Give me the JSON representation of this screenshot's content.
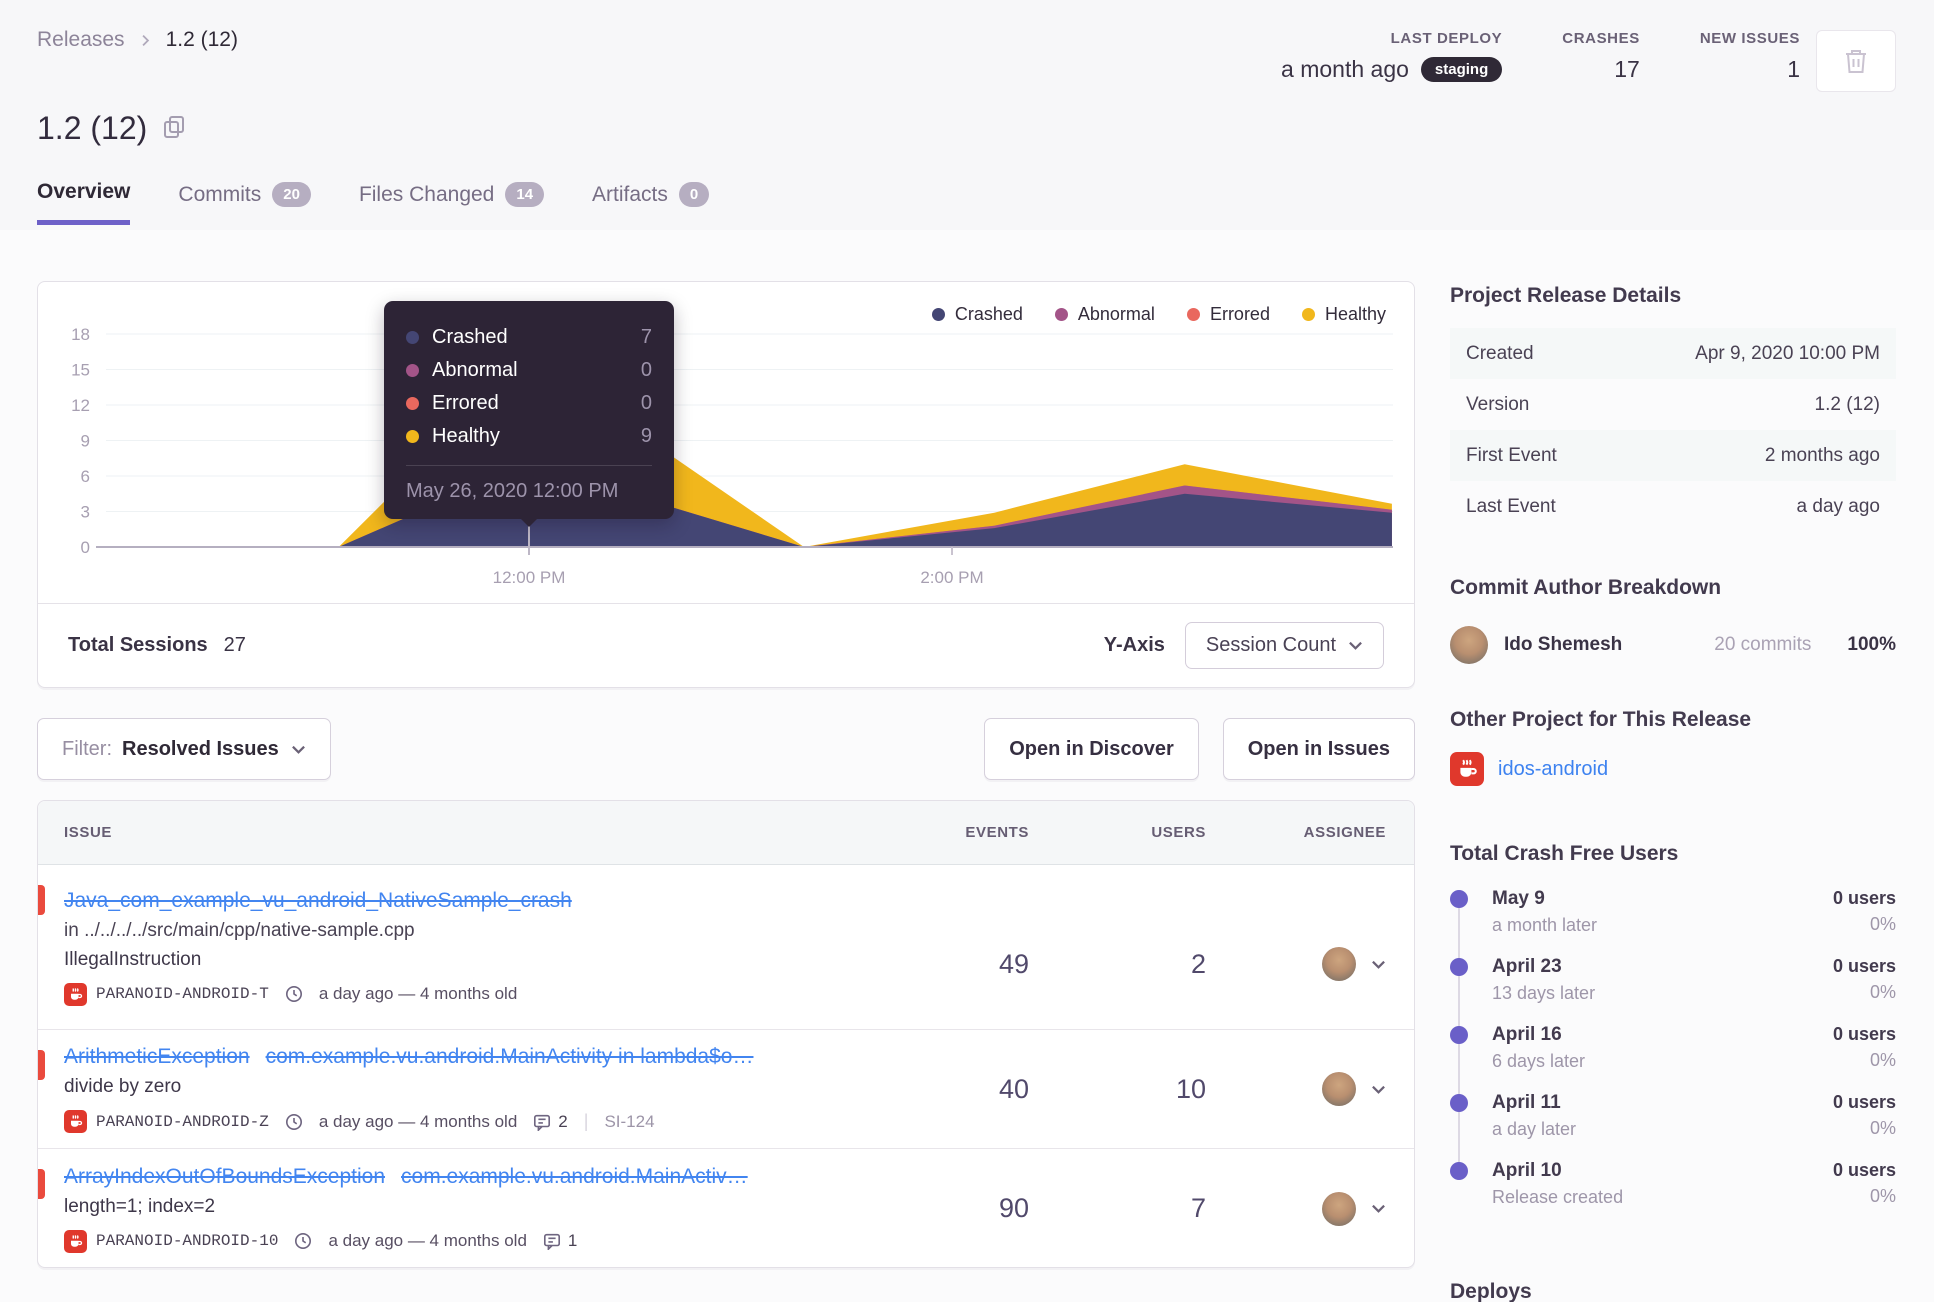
{
  "breadcrumb": {
    "section": "Releases",
    "current": "1.2 (12)"
  },
  "header_stats": {
    "last_deploy": {
      "label": "LAST DEPLOY",
      "value": "a month ago",
      "env_badge": "staging"
    },
    "crashes": {
      "label": "CRASHES",
      "value": "17"
    },
    "new_issues": {
      "label": "NEW ISSUES",
      "value": "1"
    }
  },
  "page_title": "1.2 (12)",
  "tabs": [
    {
      "label": "Overview"
    },
    {
      "label": "Commits",
      "badge": "20"
    },
    {
      "label": "Files Changed",
      "badge": "14"
    },
    {
      "label": "Artifacts",
      "badge": "0"
    }
  ],
  "colors": {
    "accent": "#6c5fc7",
    "link_blue": "#4285f0",
    "unhandled_red": "#ea4a3d",
    "crashed": "#444674",
    "abnormal": "#a35488",
    "errored": "#e9685e",
    "healthy": "#f1b71c"
  },
  "chart_card": {
    "total_sessions_label": "Total Sessions",
    "total_sessions_value": "27",
    "y_axis_label": "Y-Axis",
    "y_axis_selected": "Session Count"
  },
  "chart_data": {
    "type": "area",
    "stacked": true,
    "legend": [
      "Crashed",
      "Abnormal",
      "Errored",
      "Healthy"
    ],
    "legend_position": "top-right",
    "grid": true,
    "ylim": [
      0,
      18
    ],
    "y_ticks": [
      0,
      3,
      6,
      9,
      12,
      15,
      18
    ],
    "x_range": [
      10.0,
      16.085
    ],
    "x_ticks": [
      {
        "t": 12,
        "label": "12:00 PM"
      },
      {
        "t": 14,
        "label": "2:00 PM"
      }
    ],
    "colors": {
      "crashed": "#444674",
      "abnormal": "#a35488",
      "errored": "#e9685e",
      "healthy": "#f1b71c"
    },
    "series": [
      {
        "name": "Crashed",
        "points": [
          [
            10.0,
            0
          ],
          [
            11.1,
            0
          ],
          [
            12,
            7
          ],
          [
            13.3,
            0
          ],
          [
            14.2,
            1.6
          ],
          [
            15.1,
            4.5
          ],
          [
            16.08,
            2.9
          ]
        ]
      },
      {
        "name": "Abnormal",
        "points": [
          [
            10.0,
            0
          ],
          [
            11.1,
            0
          ],
          [
            12,
            0
          ],
          [
            13.3,
            0
          ],
          [
            14.2,
            0.2
          ],
          [
            15.1,
            0.7
          ],
          [
            16.08,
            0.25
          ]
        ]
      },
      {
        "name": "Errored",
        "points": [
          [
            10.0,
            0
          ],
          [
            11.1,
            0
          ],
          [
            12,
            0
          ],
          [
            13.3,
            0
          ],
          [
            14.2,
            0
          ],
          [
            15.1,
            0
          ],
          [
            16.08,
            0
          ]
        ]
      },
      {
        "name": "Healthy",
        "points": [
          [
            10.0,
            0
          ],
          [
            11.1,
            0
          ],
          [
            12,
            9
          ],
          [
            13.3,
            0
          ],
          [
            14.2,
            1.1
          ],
          [
            15.1,
            1.8
          ],
          [
            16.08,
            0.5
          ]
        ]
      }
    ],
    "tooltip": {
      "t": 12,
      "rows": [
        {
          "label": "Crashed",
          "value": "7"
        },
        {
          "label": "Abnormal",
          "value": "0"
        },
        {
          "label": "Errored",
          "value": "0"
        },
        {
          "label": "Healthy",
          "value": "9"
        }
      ],
      "footer": "May 26, 2020 12:00 PM"
    }
  },
  "filter_bar": {
    "filter_prefix": "Filter:",
    "filter_value": "Resolved Issues",
    "open_discover": "Open in Discover",
    "open_issues": "Open in Issues"
  },
  "issues_table": {
    "columns": {
      "issue": "ISSUE",
      "events": "EVENTS",
      "users": "USERS",
      "assignee": "ASSIGNEE"
    },
    "rows": [
      {
        "title": "Java_com_example_vu_android_NativeSample_crash",
        "subtitle": "in ../../../../src/main/cpp/native-sample.cpp",
        "message": "IllegalInstruction",
        "project": "PARANOID-ANDROID-T",
        "age": "a day ago — 4 months old",
        "events": "49",
        "users": "2"
      },
      {
        "title": "ArithmeticException",
        "title_detail": "com.example.vu.android.MainActivity in lambda$o…",
        "message": "divide by zero",
        "project": "PARANOID-ANDROID-Z",
        "age": "a day ago — 4 months old",
        "comments": "2",
        "short_id": "SI-124",
        "events": "40",
        "users": "10"
      },
      {
        "title": "ArrayIndexOutOfBoundsException",
        "title_detail": "com.example.vu.android.MainActiv…",
        "message": "length=1; index=2",
        "project": "PARANOID-ANDROID-10",
        "age": "a day ago — 4 months old",
        "comments": "1",
        "events": "90",
        "users": "7"
      }
    ]
  },
  "sidebar": {
    "release_details": {
      "heading": "Project Release Details",
      "rows": [
        {
          "label": "Created",
          "value": "Apr 9, 2020 10:00 PM"
        },
        {
          "label": "Version",
          "value": "1.2 (12)"
        },
        {
          "label": "First Event",
          "value": "2 months ago"
        },
        {
          "label": "Last Event",
          "value": "a day ago"
        }
      ]
    },
    "commit_authors": {
      "heading": "Commit Author Breakdown",
      "author": {
        "name": "Ido Shemesh",
        "commits": "20 commits",
        "percent": "100%"
      }
    },
    "other_project": {
      "heading": "Other Project for This Release",
      "project": "idos-android"
    },
    "crash_free": {
      "heading": "Total Crash Free Users",
      "items": [
        {
          "date": "May 9",
          "when": "a month later",
          "users": "0 users",
          "percent": "0%"
        },
        {
          "date": "April 23",
          "when": "13 days later",
          "users": "0 users",
          "percent": "0%"
        },
        {
          "date": "April 16",
          "when": "6 days later",
          "users": "0 users",
          "percent": "0%"
        },
        {
          "date": "April 11",
          "when": "a day later",
          "users": "0 users",
          "percent": "0%"
        },
        {
          "date": "April 10",
          "when": "Release created",
          "users": "0 users",
          "percent": "0%"
        }
      ]
    },
    "deploys_heading": "Deploys"
  }
}
